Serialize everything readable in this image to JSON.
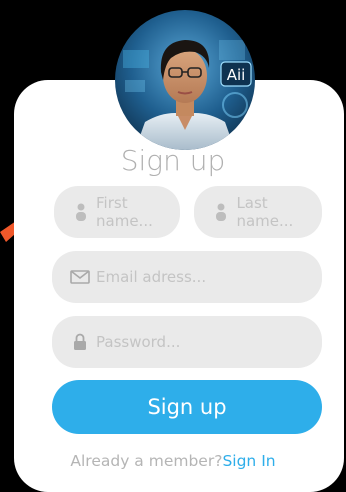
{
  "form": {
    "title": "Sign up",
    "first_name_placeholder": "First name...",
    "last_name_placeholder": "Last name...",
    "email_placeholder": "Email adress...",
    "password_placeholder": "Password...",
    "submit_label": "Sign up"
  },
  "footer": {
    "prompt": "Already a member?",
    "link_label": "Sign In"
  },
  "avatar": {
    "badge_text": "Aii"
  },
  "icons": {
    "first_name": "user-icon",
    "last_name": "user-icon",
    "email": "envelope-icon",
    "password": "lock-icon",
    "arrow": "arrow-icon"
  },
  "colors": {
    "accent": "#2eaeea",
    "field_bg": "#eaeaea",
    "placeholder": "#c4c4c4",
    "arrow": "#f0582a"
  }
}
